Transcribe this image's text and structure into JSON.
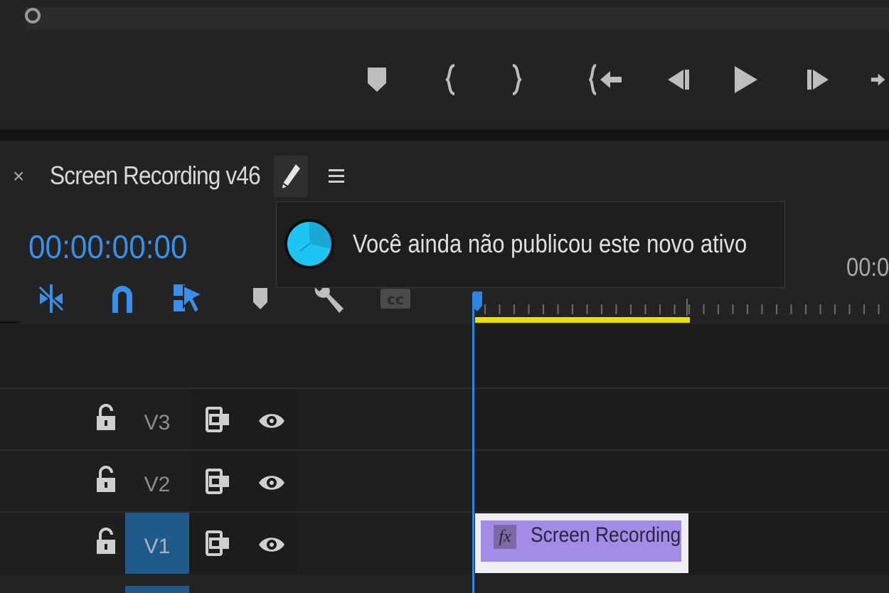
{
  "sequence": {
    "title": "Screen Recording v46",
    "close_label": "×",
    "timecode": "00:00:00:00",
    "ruler_time": "00:0"
  },
  "tooltip": {
    "message": "Você ainda não publicou este novo ativo"
  },
  "tracks": [
    {
      "label": "V3",
      "active": false
    },
    {
      "label": "V2",
      "active": false
    },
    {
      "label": "V1",
      "active": true
    }
  ],
  "clip": {
    "fx_label": "fx",
    "name": "Screen Recording"
  },
  "transport": [
    "marker-icon",
    "mark-in-icon",
    "mark-out-icon",
    "go-to-in-icon",
    "step-back-icon",
    "play-icon",
    "step-forward-icon",
    "go-to-out-icon"
  ],
  "timeline_tools": [
    "insert-snap-icon",
    "snap-magnet-icon",
    "linked-selection-icon",
    "add-marker-icon",
    "wrench-icon",
    "captions-icon"
  ],
  "colors": {
    "timecode": "#3a8fe8",
    "playhead": "#2f86e2",
    "work_area": "#e8e000",
    "clip": "#a38ce6",
    "active_track": "#1f5a8a"
  }
}
